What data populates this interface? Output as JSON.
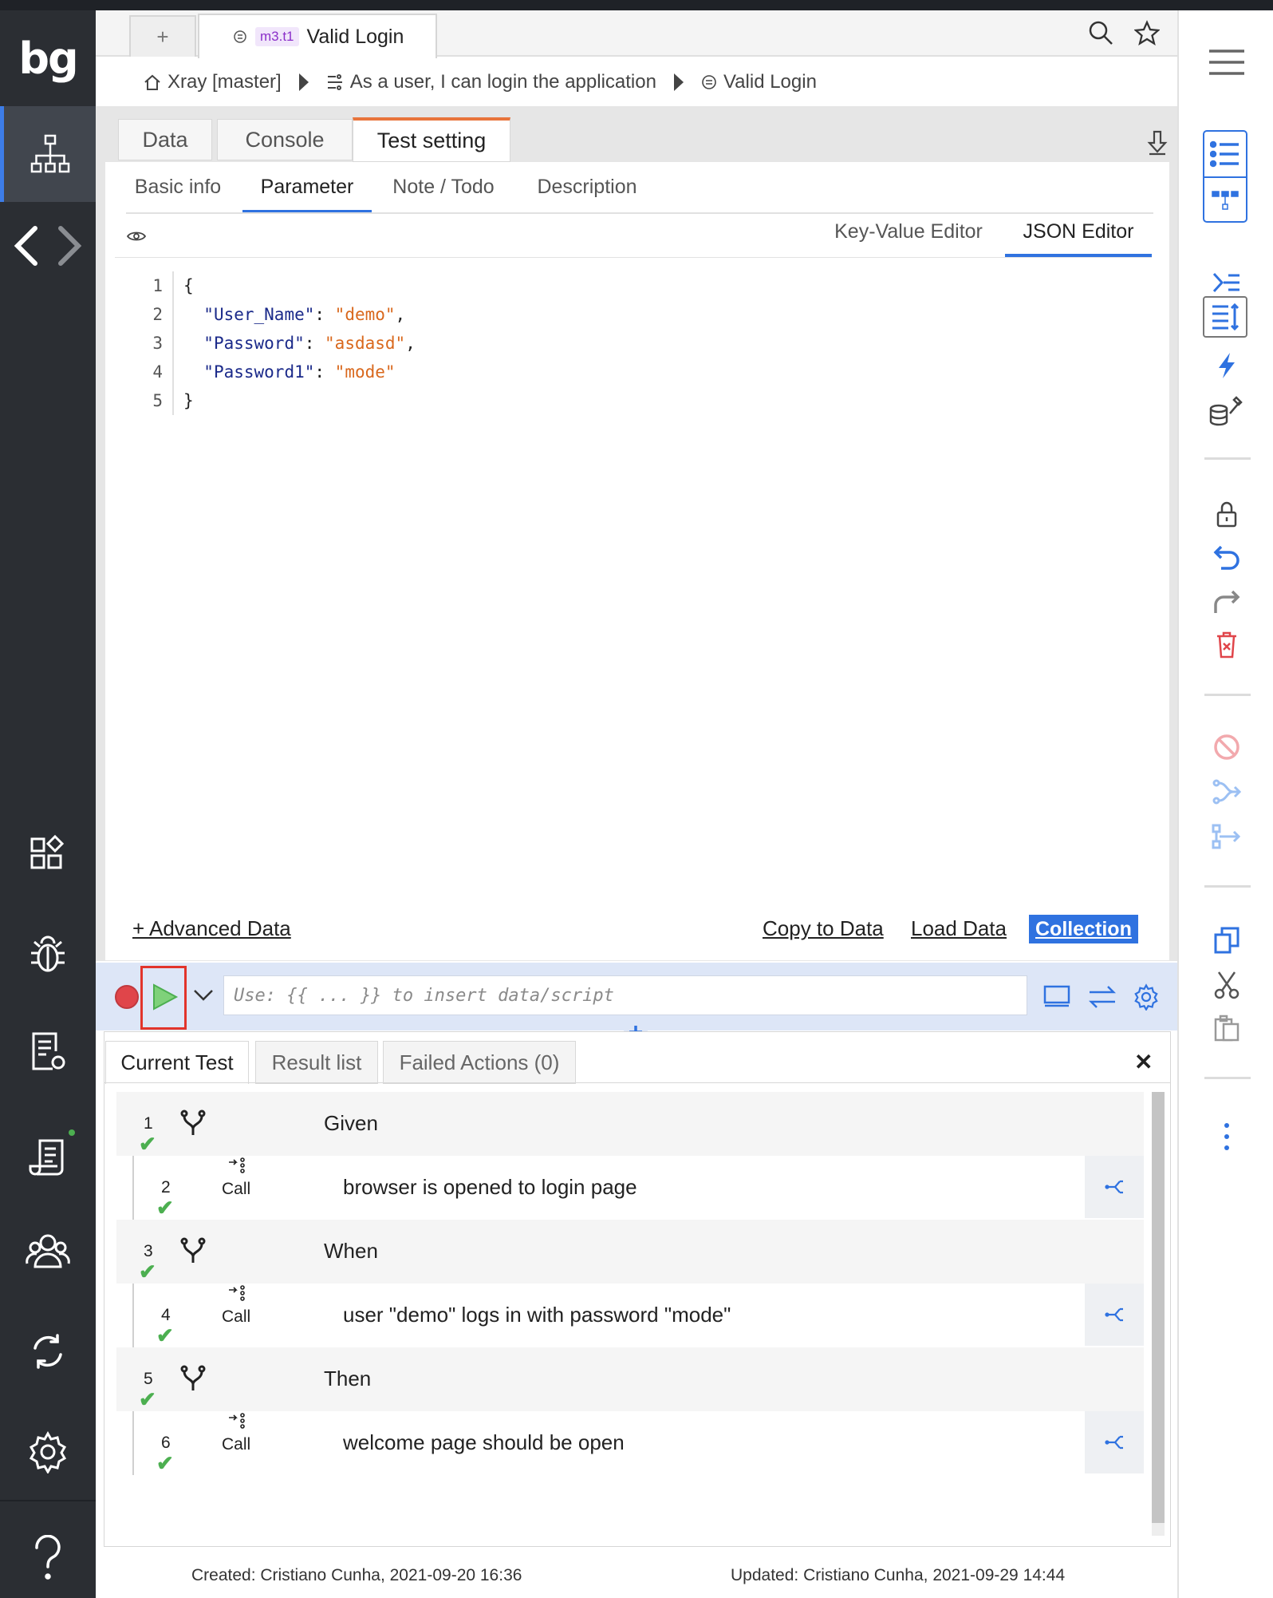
{
  "brand": {
    "logo": "bg"
  },
  "doc_tabs": {
    "add_label": "+",
    "tag": "m3.t1",
    "title": "Valid Login"
  },
  "breadcrumb": {
    "items": [
      "Xray [master]",
      "As a user, I can login the application",
      "Valid Login"
    ]
  },
  "main_tabs": [
    "Data",
    "Console",
    "Test setting"
  ],
  "sub_tabs": [
    "Basic info",
    "Parameter",
    "Note / Todo",
    "Description"
  ],
  "editor_tabs": [
    "Key-Value Editor",
    "JSON Editor"
  ],
  "json_lines": [
    {
      "n": "1",
      "text": "{"
    },
    {
      "n": "2",
      "key": "\"User_Name\"",
      "val": "\"demo\"",
      "trail": ","
    },
    {
      "n": "3",
      "key": "\"Password\"",
      "val": "\"asdasd\"",
      "trail": ","
    },
    {
      "n": "4",
      "key": "\"Password1\"",
      "val": "\"mode\"",
      "trail": ""
    },
    {
      "n": "5",
      "text": "}"
    }
  ],
  "links": {
    "advanced_data": "+ Advanced Data",
    "copy_to_data": "Copy to Data",
    "load_data": "Load Data",
    "collection": "Collection"
  },
  "runbar": {
    "placeholder": "Use: {{ ... }} to insert data/script"
  },
  "result_tabs": [
    "Current Test",
    "Result list",
    "Failed Actions (0)"
  ],
  "close_label": "✕",
  "steps": [
    {
      "num": "1",
      "keyword": "Given"
    },
    {
      "num": "2",
      "call": "Call",
      "text": "browser is opened to login page"
    },
    {
      "num": "3",
      "keyword": "When"
    },
    {
      "num": "4",
      "call": "Call",
      "text": "user \"demo\" logs in with password \"mode\""
    },
    {
      "num": "5",
      "keyword": "Then"
    },
    {
      "num": "6",
      "call": "Call",
      "text": "welcome page should be open"
    }
  ],
  "footer": {
    "created": "Created: Cristiano Cunha, 2021-09-20 16:36",
    "updated": "Updated: Cristiano Cunha, 2021-09-29 14:44"
  },
  "colors": {
    "accent": "#2f72e0",
    "active_tab": "#e8743b",
    "success": "#4caf50",
    "record": "#e0454a",
    "sidebar": "#2b2e33"
  }
}
